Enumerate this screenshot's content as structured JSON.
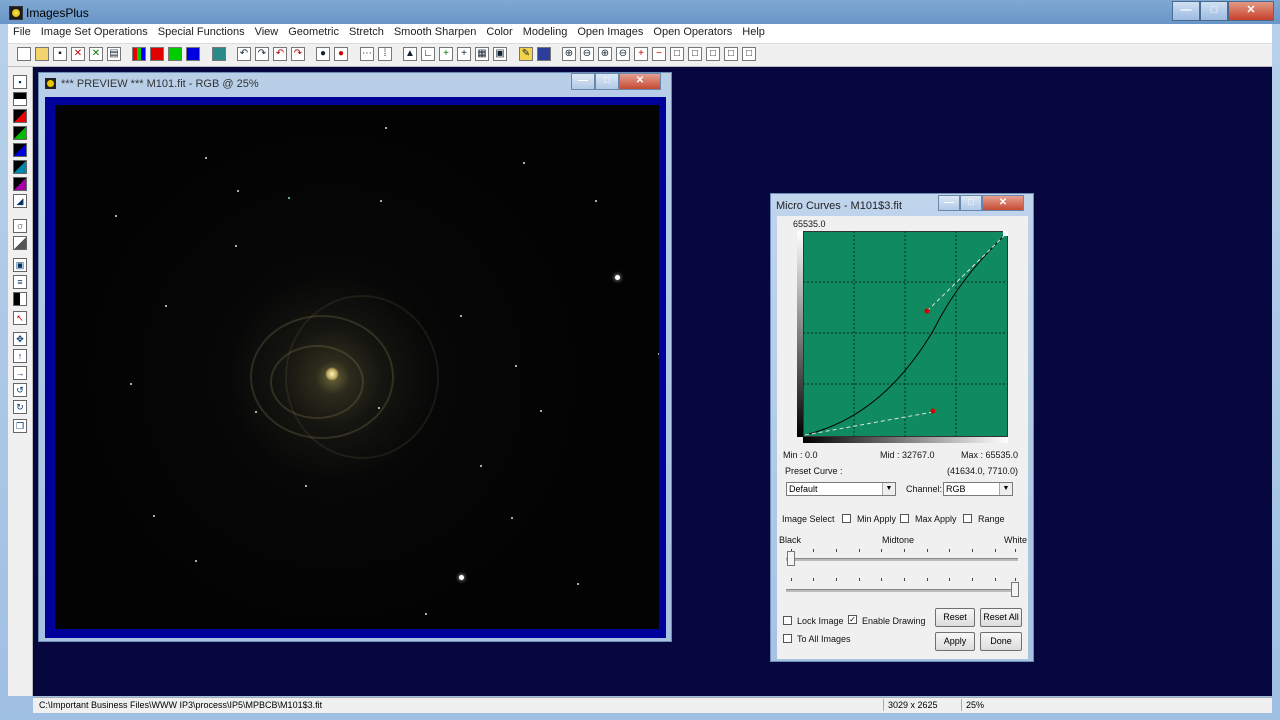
{
  "app": {
    "title": "ImagesPlus",
    "window_controls": {
      "minimize": "—",
      "maximize": "□",
      "close": "✕"
    }
  },
  "menu": [
    "File",
    "Image Set Operations",
    "Special Functions",
    "View",
    "Geometric",
    "Stretch",
    "Smooth Sharpen",
    "Color",
    "Modeling",
    "Open Images",
    "Open Operators",
    "Help"
  ],
  "toolbar": {
    "colors": {
      "red": "#e00000",
      "green": "#00cc00",
      "blue": "#0000e0"
    }
  },
  "preview_window": {
    "title": "*** PREVIEW *** M101.fit - RGB @ 25%"
  },
  "curves_dialog": {
    "title": "Micro Curves - M101$3.fit",
    "top_value": "65535.0",
    "min_label": "Min :  0.0",
    "mid_label": "Mid :  32767.0",
    "max_label": "Max :  65535.0",
    "preset_label": "Preset Curve :",
    "point_readout": "(41634.0, 7710.0)",
    "preset_value": "Default",
    "channel_label": "Channel:",
    "channel_value": "RGB",
    "image_select_label": "Image Select",
    "min_apply_label": "Min Apply",
    "max_apply_label": "Max Apply",
    "range_label": "Range",
    "black_label": "Black",
    "midtone_label": "Midtone",
    "white_label": "White",
    "lock_image_label": "Lock Image",
    "enable_drawing_label": "Enable Drawing",
    "to_all_images_label": "To All Images",
    "reset_label": "Reset",
    "reset_all_label": "Reset All",
    "apply_label": "Apply",
    "done_label": "Done",
    "enable_drawing_checked": true,
    "grid_color": "#108a60"
  },
  "status": {
    "path": "C:\\Important Business Files\\WWW IP3\\process\\IP5\\MPBCB\\M101$3.fit",
    "dimensions": "3029 x 2625",
    "zoom": "25%"
  }
}
